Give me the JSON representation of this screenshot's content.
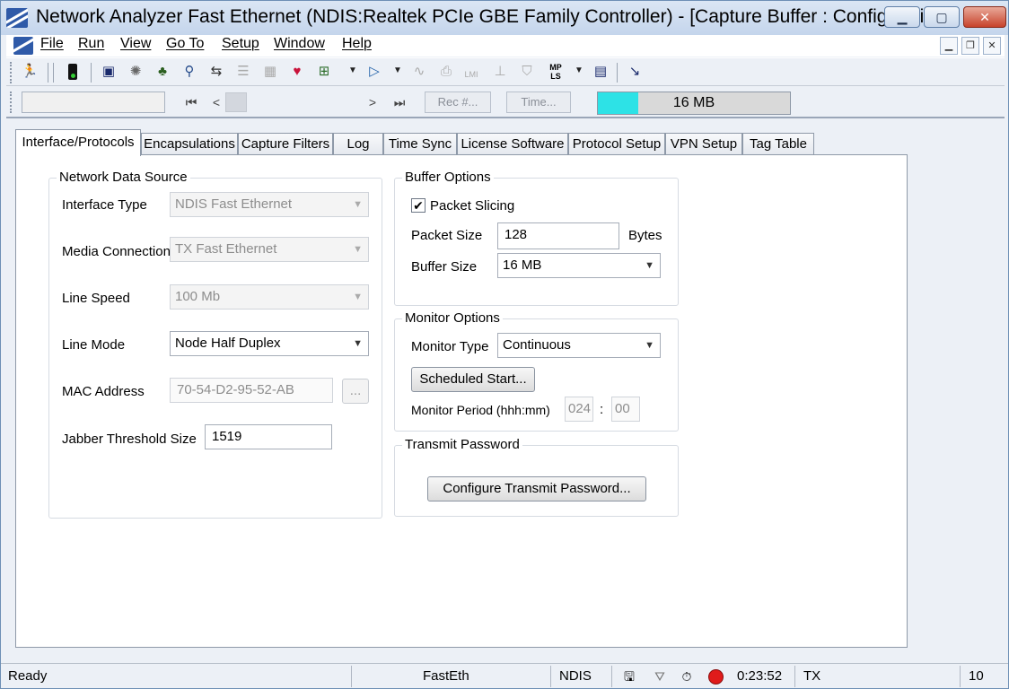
{
  "window": {
    "title": "Network Analyzer Fast Ethernet (NDIS:Realtek PCIe GBE Family Controller) - [Capture Buffer : Configuration]"
  },
  "menu": [
    "File",
    "Run",
    "View",
    "Go To",
    "Setup",
    "Window",
    "Help"
  ],
  "toolbar": {
    "icons": [
      "run-icon",
      "traffic-light-icon",
      "capture-icon",
      "idea-icon",
      "network-icon",
      "search-network-icon",
      "flow-icon",
      "list-icon",
      "list-grid-icon",
      "heart-icon",
      "tree-icon",
      "filter-arrow-icon",
      "chart-icon",
      "printer-icon",
      "lmi-icon",
      "hierarchy-icon",
      "shield-icon",
      "mpls-icon",
      "table-icon",
      "tool-icon"
    ],
    "mpls_label": "MP LS",
    "lmi_label": "LMI"
  },
  "navigation": {
    "rec_button": "Rec #...",
    "time_button": "Time...",
    "memory": {
      "label": "16 MB",
      "fill_fraction": 0.21,
      "fill_color": "#2de2e6"
    }
  },
  "tabs": [
    "Interface/Protocols",
    "Encapsulations",
    "Capture Filters",
    "Log",
    "Time Sync",
    "License Software",
    "Protocol Setup",
    "VPN Setup",
    "Tag Table"
  ],
  "network_data_source": {
    "title": "Network Data Source",
    "interface_type": {
      "label": "Interface Type",
      "value": "NDIS Fast Ethernet"
    },
    "media_connection": {
      "label": "Media Connection",
      "value": "TX Fast Ethernet"
    },
    "line_speed": {
      "label": "Line Speed",
      "value": "100 Mb"
    },
    "line_mode": {
      "label": "Line Mode",
      "value": "Node Half Duplex"
    },
    "mac_address": {
      "label": "MAC Address",
      "value": "70-54-D2-95-52-AB",
      "browse_label": "..."
    },
    "jabber_threshold": {
      "label": "Jabber Threshold Size",
      "value": "1519"
    }
  },
  "buffer_options": {
    "title": "Buffer Options",
    "packet_slicing": {
      "label": "Packet Slicing",
      "checked": true,
      "check_mark": "✔"
    },
    "packet_size": {
      "label": "Packet Size",
      "value": "128",
      "unit": "Bytes"
    },
    "buffer_size": {
      "label": "Buffer Size",
      "value": "16 MB"
    }
  },
  "monitor_options": {
    "title": "Monitor Options",
    "monitor_type": {
      "label": "Monitor Type",
      "value": "Continuous"
    },
    "scheduled_start": "Scheduled Start...",
    "monitor_period": {
      "label": "Monitor Period (hhh:mm)",
      "hours": "024",
      "separator": ":",
      "minutes": "00"
    }
  },
  "transmit_password": {
    "title": "Transmit Password",
    "configure_button": "Configure Transmit Password..."
  },
  "status_bar": {
    "state": "Ready",
    "interface": "FastEth",
    "driver": "NDIS",
    "elapsed": "0:23:52",
    "mode": "TX",
    "percent": "10"
  }
}
